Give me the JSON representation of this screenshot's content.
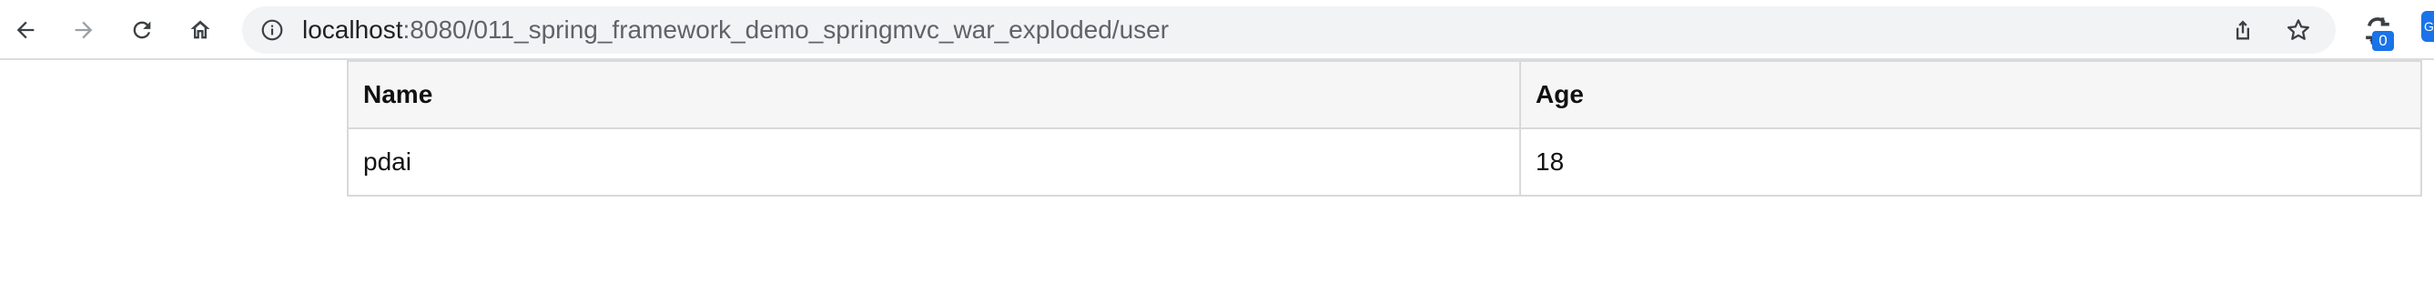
{
  "browser": {
    "url_host": "localhost",
    "url_rest": ":8080/011_spring_framework_demo_springmvc_war_exploded/user",
    "extension_badge": "0",
    "profile_letter": "G",
    "icons": [
      "back-icon",
      "forward-icon",
      "reload-icon",
      "home-icon",
      "info-icon",
      "share-icon",
      "star-icon",
      "extension-icon"
    ]
  },
  "table": {
    "headers": [
      "Name",
      "Age"
    ],
    "rows": [
      [
        "pdai",
        "18"
      ]
    ]
  },
  "colors": {
    "toolbar_bg": "#ffffff",
    "omnibox_bg": "#f1f3f4",
    "table_header_bg": "#f6f6f6",
    "table_border": "#d9d9d9",
    "accent": "#1a73e8"
  }
}
